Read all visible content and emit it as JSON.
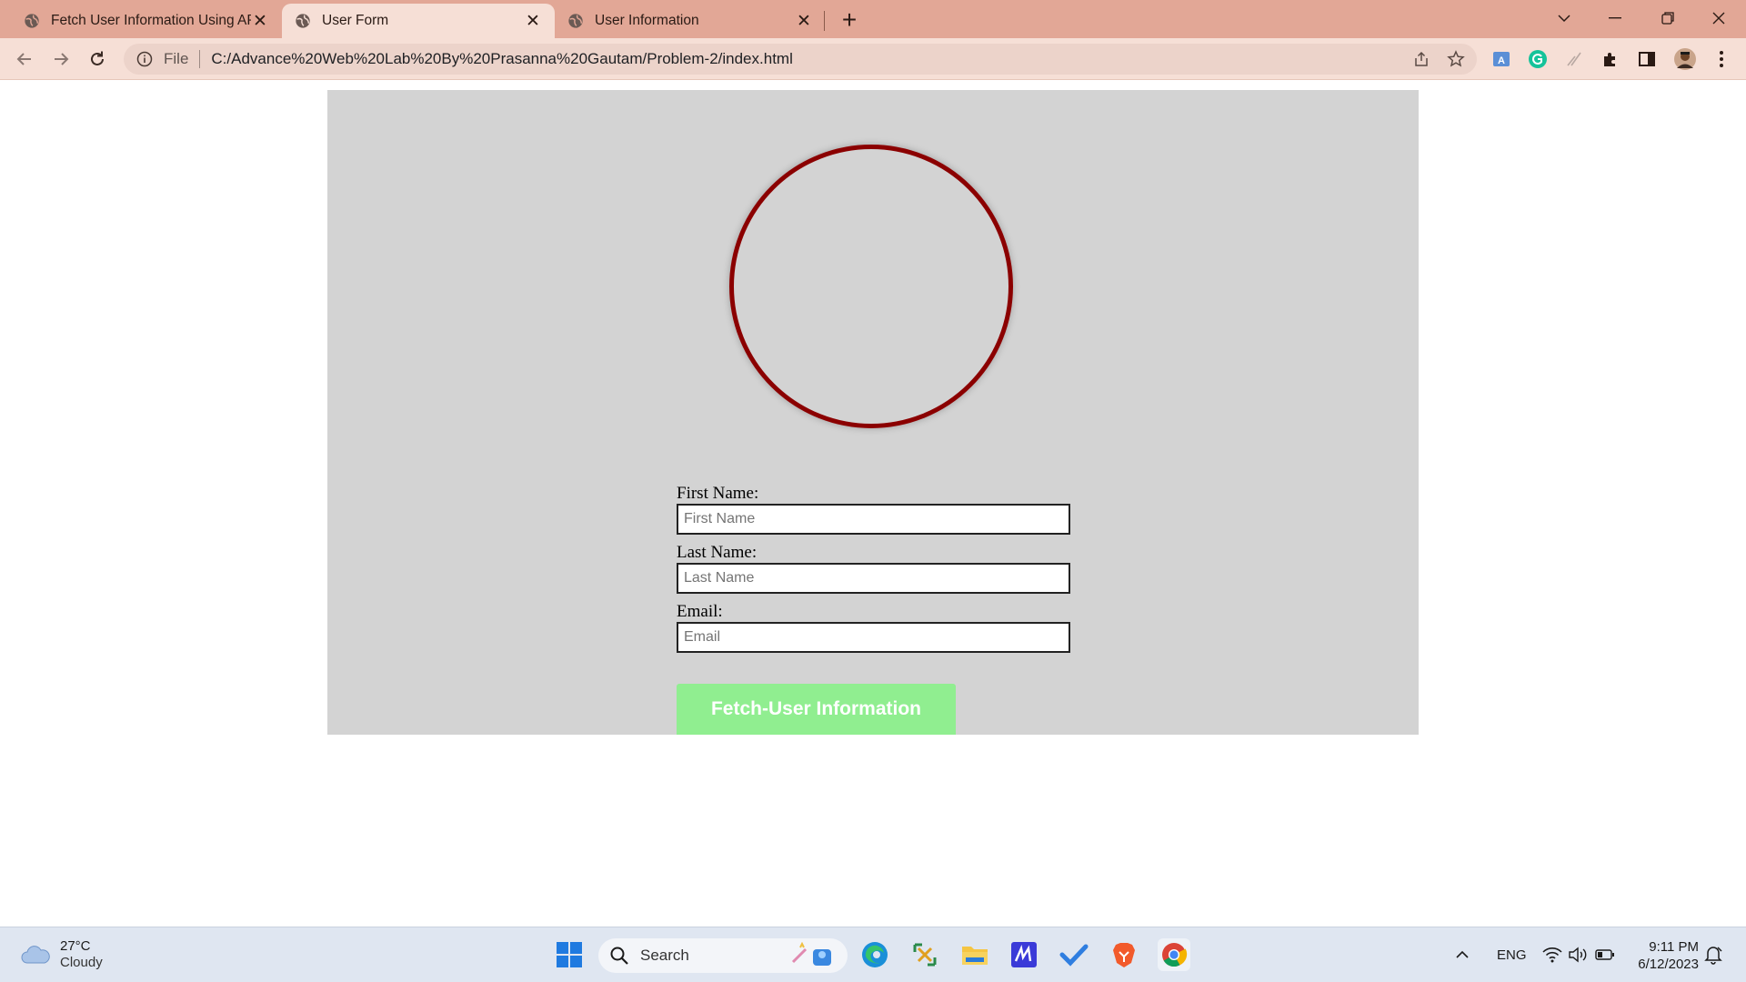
{
  "browser": {
    "tabs": [
      {
        "title": "Fetch User Information Using API",
        "active": false
      },
      {
        "title": "User Form",
        "active": true
      },
      {
        "title": "User Information",
        "active": false
      }
    ],
    "new_tab_label": "+",
    "address": {
      "scheme_label": "File",
      "url": "C:/Advance%20Web%20Lab%20By%20Prasanna%20Gautam/Problem-2/index.html"
    },
    "icons": [
      "back-icon",
      "forward-icon",
      "reload-icon",
      "info-icon",
      "share-icon",
      "star-icon",
      "extensions-icon",
      "sidepanel-icon",
      "menu-icon"
    ]
  },
  "page": {
    "colors": {
      "container": "#d3d3d3",
      "circle_border": "#8b0000",
      "button": "#90ee90"
    },
    "form": {
      "first_name": {
        "label": "First Name:",
        "placeholder": "First Name"
      },
      "last_name": {
        "label": "Last Name:",
        "placeholder": "Last Name"
      },
      "email": {
        "label": "Email:",
        "placeholder": "Email"
      }
    },
    "fetch_button": "Fetch-User Information"
  },
  "taskbar": {
    "weather": {
      "temp": "27°C",
      "condition": "Cloudy"
    },
    "search_placeholder": "Search",
    "language": "ENG",
    "time": "9:11 PM",
    "date": "6/12/2023"
  }
}
